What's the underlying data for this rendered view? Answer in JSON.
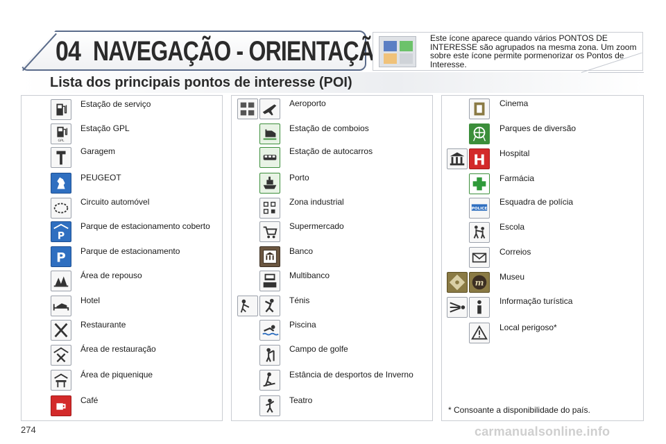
{
  "header": {
    "chapter_number": "04",
    "chapter_title": "NAVEGAÇÃO - ORIENTAÇÃO"
  },
  "multi_poi_note": "Este ícone aparece quando vários PONTOS DE INTERESSE são agrupados na mesma zona. Um zoom sobre este ícone permite pormenorizar os Pontos de Interesse.",
  "section_title": "Lista dos principais pontos de interesse (POI)",
  "columns": [
    {
      "items": [
        {
          "label": "Estação de serviço",
          "icon": "fuel-pump-icon"
        },
        {
          "label": "Estação GPL",
          "icon": "lpg-pump-icon"
        },
        {
          "label": "Garagem",
          "icon": "wrench-icon"
        },
        {
          "label": "PEUGEOT",
          "icon": "peugeot-lion-icon"
        },
        {
          "label": "Circuito automóvel",
          "icon": "race-track-icon"
        },
        {
          "label": "Parque de estacionamento coberto",
          "icon": "covered-parking-icon"
        },
        {
          "label": "Parque de estacionamento",
          "icon": "parking-icon"
        },
        {
          "label": "Área de repouso",
          "icon": "rest-area-icon"
        },
        {
          "label": "Hotel",
          "icon": "hotel-bed-icon"
        },
        {
          "label": "Restaurante",
          "icon": "fork-knife-icon"
        },
        {
          "label": "Área de restauração",
          "icon": "restaurant-area-icon"
        },
        {
          "label": "Área de piquenique",
          "icon": "picnic-table-icon"
        },
        {
          "label": "Café",
          "icon": "coffee-cup-icon"
        }
      ]
    },
    {
      "items": [
        {
          "label": "Aeroporto",
          "icon": "airplane-icon"
        },
        {
          "label": "Estação de comboios",
          "icon": "train-icon"
        },
        {
          "label": "Estação de autocarros",
          "icon": "bus-icon"
        },
        {
          "label": "Porto",
          "icon": "ship-icon"
        },
        {
          "label": "Zona industrial",
          "icon": "factory-icon"
        },
        {
          "label": "Supermercado",
          "icon": "shopping-cart-icon"
        },
        {
          "label": "Banco",
          "icon": "bank-icon"
        },
        {
          "label": "Multibanco",
          "icon": "atm-icon"
        },
        {
          "label": "Ténis",
          "icon": "tennis-icon"
        },
        {
          "label": "Piscina",
          "icon": "swimmer-icon"
        },
        {
          "label": "Campo de golfe",
          "icon": "golfer-icon"
        },
        {
          "label": "Estância de desportos de Inverno",
          "icon": "skier-icon"
        },
        {
          "label": "Teatro",
          "icon": "theatre-icon"
        }
      ]
    },
    {
      "items": [
        {
          "label": "Cinema",
          "icon": "film-icon"
        },
        {
          "label": "Parques de diversão",
          "icon": "amusement-park-icon"
        },
        {
          "label": "Hospital",
          "icon": "hospital-icon"
        },
        {
          "label": "Farmácia",
          "icon": "pharmacy-cross-icon"
        },
        {
          "label": "Esquadra de polícia",
          "icon": "police-icon"
        },
        {
          "label": "Escola",
          "icon": "school-children-icon"
        },
        {
          "label": "Correios",
          "icon": "envelope-icon"
        },
        {
          "label": "Museu",
          "icon": "museum-icon"
        },
        {
          "label": "Informação turística",
          "icon": "tourist-info-icon"
        },
        {
          "label": "Local perigoso*",
          "icon": "warning-triangle-icon"
        }
      ]
    }
  ],
  "footnote": "* Consoante a disponibilidade do país.",
  "page_number": "274",
  "watermark": "carmanualsonline.info",
  "colors": {
    "header_border": "#5a6b8a",
    "icon_blue": "#2f6fc0",
    "icon_green": "#3b8e3a",
    "icon_red": "#d32a2a"
  }
}
